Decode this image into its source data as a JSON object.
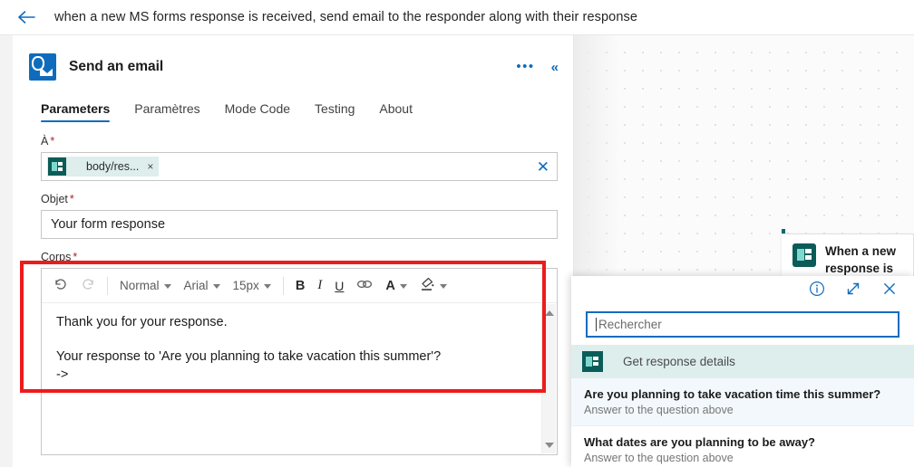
{
  "topbar": {
    "back_icon": "arrow-left-icon",
    "flow_title": "when a new MS forms response is received, send email to the responder along with their response"
  },
  "panel": {
    "action_icon": "outlook-icon",
    "action_title": "Send an email",
    "more_label": "•••",
    "collapse_label": "«",
    "tabs": [
      {
        "label": "Parameters",
        "active": true
      },
      {
        "label": "Paramètres",
        "active": false
      },
      {
        "label": "Mode Code",
        "active": false
      },
      {
        "label": "Testing",
        "active": false
      },
      {
        "label": "About",
        "active": false
      }
    ],
    "fields": {
      "to": {
        "label": "À",
        "required_mark": "*",
        "token_text": "body/res...",
        "token_remove": "×",
        "clear_label": "✕"
      },
      "subject": {
        "label": "Objet",
        "required_mark": "*",
        "value": "Your form response"
      },
      "body": {
        "label": "Corps",
        "required_mark": "*",
        "toolbar": {
          "undo": "↺",
          "redo": "↻",
          "style": "Normal",
          "font": "Arial",
          "size": "15px",
          "bold": "B",
          "italic": "I",
          "underline": "U",
          "link": "∞",
          "font_color": "A",
          "highlight": "✒"
        },
        "line1": "Thank you for your response.",
        "line2": "Your response to 'Are you planning to take vacation this summer'?",
        "line3": "->"
      }
    }
  },
  "canvas": {
    "trigger_card": {
      "icon": "forms-icon",
      "title": "When a new response is"
    }
  },
  "flyout": {
    "info_icon": "info-icon",
    "expand_icon": "expand-icon",
    "close_icon": "close-icon",
    "search_placeholder": "Rechercher",
    "group": {
      "icon": "forms-icon",
      "label": "Get response details"
    },
    "items": [
      {
        "title": "Are you planning to take vacation time this summer?",
        "subtitle": "Answer to the question above",
        "highlighted": true
      },
      {
        "title": "What dates are you planning to be away?",
        "subtitle": "Answer to the question above",
        "highlighted": false
      }
    ]
  },
  "annotation": {
    "color": "#ee1b1b"
  }
}
